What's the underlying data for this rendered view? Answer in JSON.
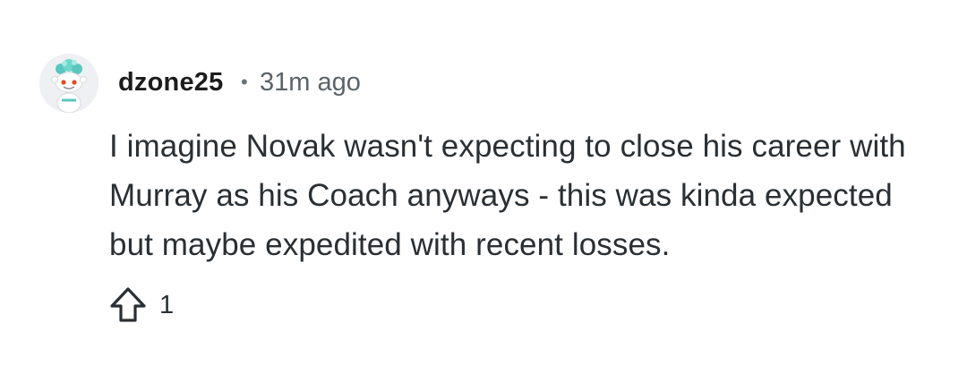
{
  "comment": {
    "author": "dzone25",
    "separator": "•",
    "time": "31m ago",
    "body": "I imagine Novak wasn't expecting to close his career with Murray as his Coach anyways - this was kinda expected but maybe expedited with recent losses.",
    "vote_count": "1"
  },
  "icons": {
    "avatar": "snoo-avatar-icon",
    "upvote": "upvote-arrow-icon"
  },
  "colors": {
    "text": "#1c1c1c",
    "muted": "#5a6368",
    "avatar_bg": "#eef0f3",
    "avatar_accent": "#58c7bd"
  }
}
